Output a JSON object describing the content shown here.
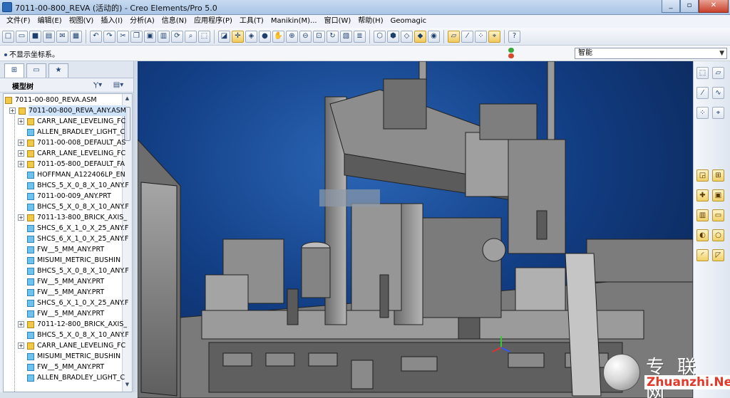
{
  "window": {
    "title": "7011-00-800_REVA (活动的) - Creo Elements/Pro 5.0",
    "buttons": [
      "minimize",
      "maximize",
      "close"
    ]
  },
  "menu": [
    "文件(F)",
    "编辑(E)",
    "视图(V)",
    "插入(I)",
    "分析(A)",
    "信息(N)",
    "应用程序(P)",
    "工具(T)",
    "Manikin(M)...",
    "窗口(W)",
    "帮助(H)",
    "Geomagic"
  ],
  "toolbar": [
    {
      "icon": "new-file-icon",
      "glyph": "□"
    },
    {
      "icon": "open-folder-icon",
      "glyph": "▭"
    },
    {
      "icon": "save-icon",
      "glyph": "■"
    },
    {
      "icon": "print-icon",
      "glyph": "▤"
    },
    {
      "icon": "send-mail-icon",
      "glyph": "✉"
    },
    {
      "icon": "print-preview-icon",
      "glyph": "▦"
    },
    {
      "sep": true
    },
    {
      "icon": "undo-icon",
      "glyph": "↶"
    },
    {
      "icon": "redo-icon",
      "glyph": "↷"
    },
    {
      "icon": "cut-icon",
      "glyph": "✂"
    },
    {
      "icon": "copy-icon",
      "glyph": "❐"
    },
    {
      "icon": "paste-icon",
      "glyph": "▣"
    },
    {
      "icon": "paste-special-icon",
      "glyph": "▥"
    },
    {
      "icon": "regenerate-icon",
      "glyph": "⟳"
    },
    {
      "icon": "find-icon",
      "glyph": "⌕"
    },
    {
      "icon": "select-box-icon",
      "glyph": "⬚"
    },
    {
      "sep": true
    },
    {
      "icon": "repaint-icon",
      "glyph": "◪"
    },
    {
      "icon": "spin-center-icon",
      "glyph": "✛",
      "selected": true
    },
    {
      "icon": "orient-mode-icon",
      "glyph": "◈"
    },
    {
      "icon": "appearance-ball-icon",
      "glyph": "●"
    },
    {
      "icon": "pan-hand-icon",
      "glyph": "✋"
    },
    {
      "icon": "zoom-in-icon",
      "glyph": "⊕"
    },
    {
      "icon": "zoom-out-icon",
      "glyph": "⊖"
    },
    {
      "icon": "refit-icon",
      "glyph": "⊡"
    },
    {
      "icon": "reorient-icon",
      "glyph": "↻"
    },
    {
      "icon": "saved-views-icon",
      "glyph": "▧"
    },
    {
      "icon": "layers-icon",
      "glyph": "≣"
    },
    {
      "sep": true
    },
    {
      "icon": "wireframe-icon",
      "glyph": "⬡"
    },
    {
      "icon": "hidden-line-icon",
      "glyph": "⬢"
    },
    {
      "icon": "no-hidden-icon",
      "glyph": "◇"
    },
    {
      "icon": "shading-icon",
      "glyph": "◆",
      "selected": true
    },
    {
      "icon": "enhanced-realism-icon",
      "glyph": "◉"
    },
    {
      "sep": true
    },
    {
      "icon": "datum-planes-icon",
      "glyph": "▱",
      "selected": true
    },
    {
      "icon": "datum-axes-icon",
      "glyph": "⁄"
    },
    {
      "icon": "datum-points-icon",
      "glyph": "⁘"
    },
    {
      "icon": "coordinate-systems-icon",
      "glyph": "⌖",
      "selected": true
    },
    {
      "sep": true
    },
    {
      "icon": "context-help-icon",
      "glyph": "?"
    }
  ],
  "status": {
    "message": "不显示坐标系。",
    "filter_value": "智能"
  },
  "navigator": {
    "tabs": [
      "model-tree-tab-icon",
      "folder-browser-tab-icon",
      "favorites-tab-icon"
    ],
    "tree_title": "模型树",
    "root": "7011-00-800_REVA.ASM",
    "items": [
      {
        "label": "7011-00-800_REVA_ANY.ASM",
        "type": "asm",
        "expandable": true,
        "level": 0,
        "highlight": true
      },
      {
        "label": "CARR_LANE_LEVELING_FC",
        "type": "asm",
        "expandable": true,
        "level": 1
      },
      {
        "label": "ALLEN_BRADLEY_LIGHT_C",
        "type": "prt",
        "expandable": false,
        "level": 1
      },
      {
        "label": "7011-00-008_DEFAULT_AS",
        "type": "asm",
        "expandable": true,
        "level": 1
      },
      {
        "label": "CARR_LANE_LEVELING_FC",
        "type": "asm",
        "expandable": true,
        "level": 1
      },
      {
        "label": "7011-05-800_DEFAULT_FA",
        "type": "asm",
        "expandable": true,
        "level": 1
      },
      {
        "label": "HOFFMAN_A122406LP_EN",
        "type": "prt",
        "expandable": false,
        "level": 1
      },
      {
        "label": "BHCS_5_X_0_8_X_10_ANY.F",
        "type": "prt",
        "expandable": false,
        "level": 1
      },
      {
        "label": "7011-00-009_ANY.PRT",
        "type": "prt",
        "expandable": false,
        "level": 1
      },
      {
        "label": "BHCS_5_X_0_8_X_10_ANY.F",
        "type": "prt",
        "expandable": false,
        "level": 1
      },
      {
        "label": "7011-13-800_BRICK_AXIS_",
        "type": "asm",
        "expandable": true,
        "level": 1
      },
      {
        "label": "SHCS_6_X_1_0_X_25_ANY.F",
        "type": "prt",
        "expandable": false,
        "level": 1
      },
      {
        "label": "SHCS_6_X_1_0_X_25_ANY.F",
        "type": "prt",
        "expandable": false,
        "level": 1
      },
      {
        "label": "FW__5_MM_ANY.PRT",
        "type": "prt",
        "expandable": false,
        "level": 1
      },
      {
        "label": "MISUMI_METRIC_BUSHIN",
        "type": "prt",
        "expandable": false,
        "level": 1
      },
      {
        "label": "BHCS_5_X_0_8_X_10_ANY.F",
        "type": "prt",
        "expandable": false,
        "level": 1
      },
      {
        "label": "FW__5_MM_ANY.PRT",
        "type": "prt",
        "expandable": false,
        "level": 1
      },
      {
        "label": "FW__5_MM_ANY.PRT",
        "type": "prt",
        "expandable": false,
        "level": 1
      },
      {
        "label": "SHCS_6_X_1_0_X_25_ANY.F",
        "type": "prt",
        "expandable": false,
        "level": 1
      },
      {
        "label": "FW__5_MM_ANY.PRT",
        "type": "prt",
        "expandable": false,
        "level": 1
      },
      {
        "label": "7011-12-800_BRICK_AXIS_",
        "type": "asm",
        "expandable": true,
        "level": 1
      },
      {
        "label": "BHCS_5_X_0_8_X_10_ANY.F",
        "type": "prt",
        "expandable": false,
        "level": 1
      },
      {
        "label": "CARR_LANE_LEVELING_FC",
        "type": "asm",
        "expandable": true,
        "level": 1
      },
      {
        "label": "MISUMI_METRIC_BUSHIN",
        "type": "prt",
        "expandable": false,
        "level": 1
      },
      {
        "label": "FW__5_MM_ANY.PRT",
        "type": "prt",
        "expandable": false,
        "level": 1
      },
      {
        "label": "ALLEN_BRADLEY_LIGHT_C",
        "type": "prt",
        "expandable": false,
        "level": 1
      }
    ]
  },
  "right_toolbar": [
    "datum-plane-tool-icon",
    "datum-axis-tool-icon",
    "sketch-tool-icon",
    "datum-curve-icon",
    "datum-point-icon",
    "coordinate-system-tool-icon",
    "analysis-feature-icon",
    "assemble-icon",
    "create-component-icon",
    "package-icon",
    "repeat-component-icon",
    "extrude-icon",
    "revolve-icon",
    "hole-icon",
    "round-icon",
    "chamfer-icon"
  ],
  "watermark": {
    "cn": "专联网",
    "url": "Zhuanzhi.Net"
  },
  "colors": {
    "viewport_bg": "#173f8a",
    "accent": "#2a6ab7",
    "model_gray": "#8c8c8c"
  }
}
